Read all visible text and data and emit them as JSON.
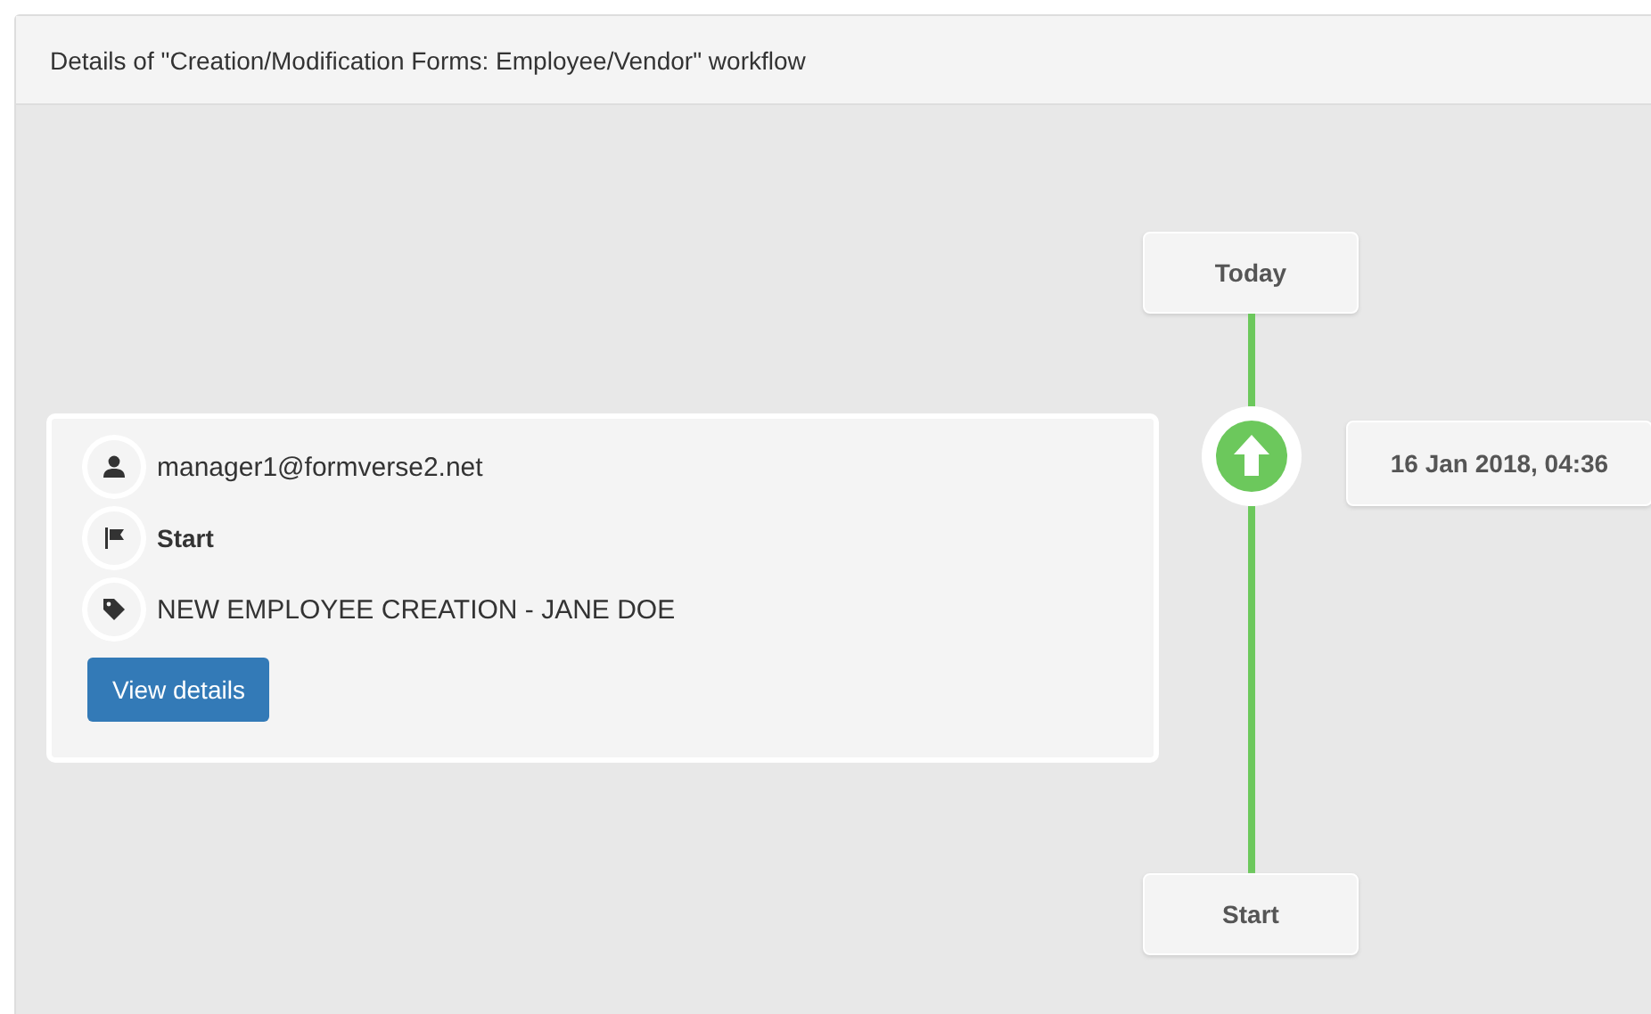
{
  "panel": {
    "title": "Details of \"Creation/Modification Forms: Employee/Vendor\" workflow"
  },
  "timeline": {
    "top_label": "Today",
    "bottom_label": "Start",
    "event": {
      "user": "manager1@formverse2.net",
      "action": "Start",
      "tag": "NEW EMPLOYEE CREATION - JANE DOE",
      "button": "View details",
      "date": "16 Jan 2018, 04:36"
    }
  }
}
